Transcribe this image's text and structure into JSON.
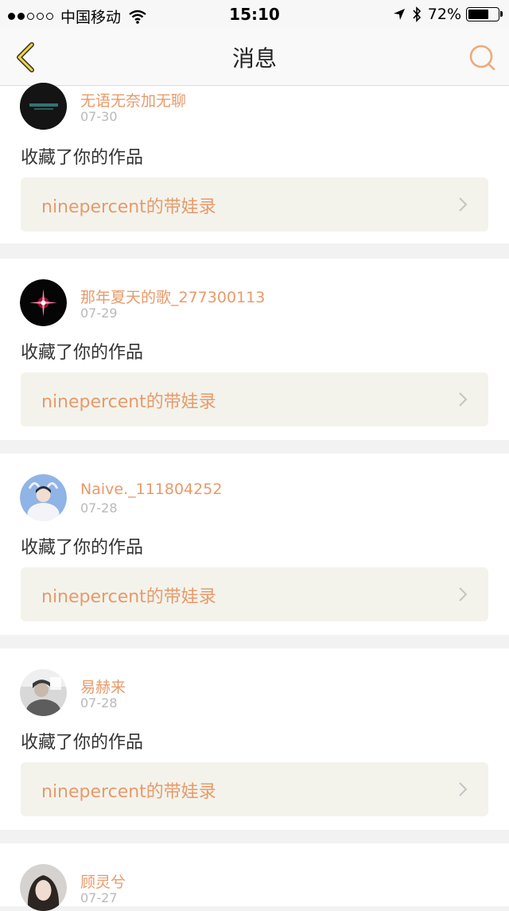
{
  "status_bar": {
    "carrier": "中国移动",
    "time": "15:10",
    "battery_text": "72%",
    "battery_level": 0.72,
    "signal_full": 2,
    "signal_total": 5
  },
  "nav": {
    "title": "消息",
    "accent_color": "#e89a6a"
  },
  "notifications": [
    {
      "user": "无语无奈加无聊",
      "date": "07-30",
      "action": "收藏了你的作品",
      "work": "ninepercent的带娃录",
      "avatar": "dark-text-avatar"
    },
    {
      "user": "那年夏天的歌_277300113",
      "date": "07-29",
      "action": "收藏了你的作品",
      "work": "ninepercent的带娃录",
      "avatar": "red-star-avatar"
    },
    {
      "user": "Naive._111804252",
      "date": "07-28",
      "action": "收藏了你的作品",
      "work": "ninepercent的带娃录",
      "avatar": "blue-photo-avatar"
    },
    {
      "user": "易赫来",
      "date": "07-28",
      "action": "收藏了你的作品",
      "work": "ninepercent的带娃录",
      "avatar": "gray-photo-avatar"
    },
    {
      "user": "顾灵兮",
      "date": "07-27",
      "action": "",
      "work": "",
      "avatar": "portrait-avatar"
    }
  ]
}
